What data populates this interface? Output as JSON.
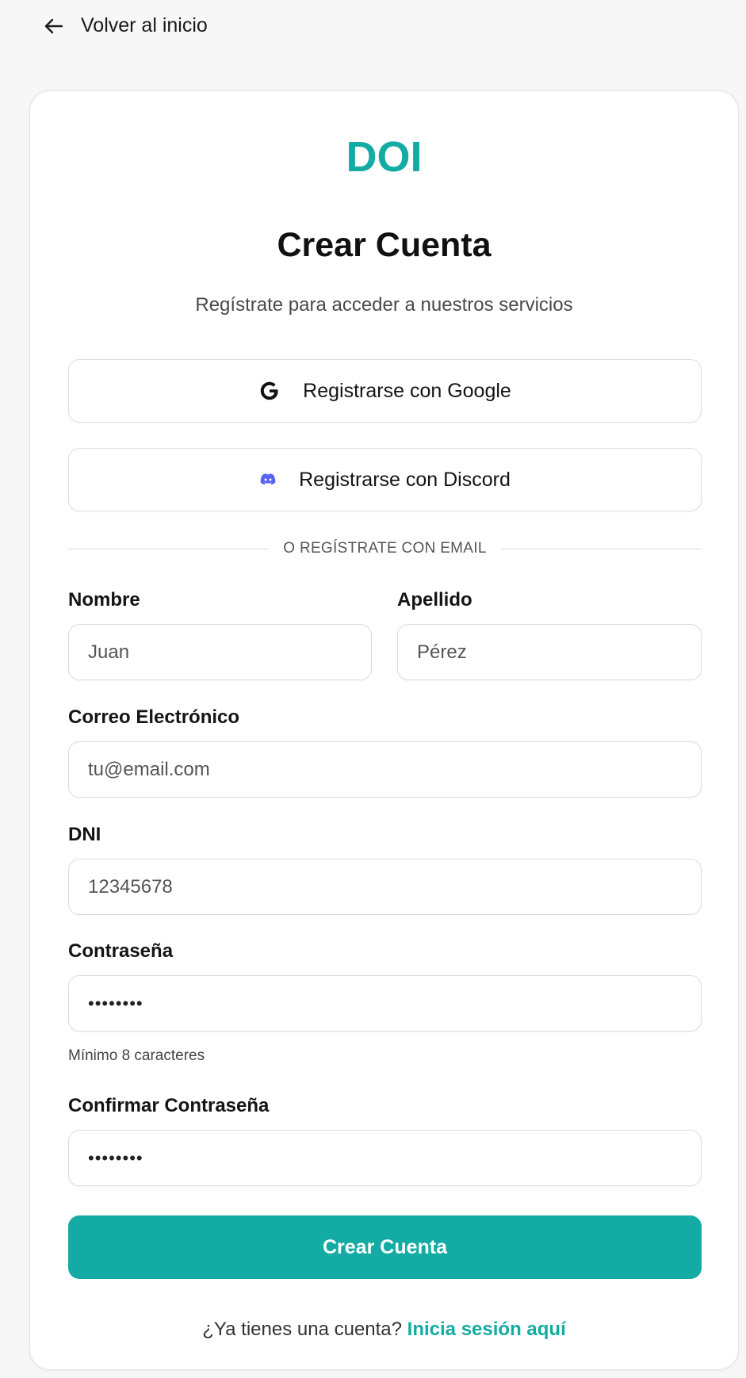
{
  "nav": {
    "back_label": "Volver al inicio"
  },
  "brand": {
    "logo_text": "DOI",
    "accent_color": "#13aba3"
  },
  "header": {
    "title": "Crear Cuenta",
    "subtitle": "Regístrate para acceder a nuestros servicios"
  },
  "oauth": {
    "google_label": "Registrarse con Google",
    "discord_label": "Registrarse con Discord"
  },
  "divider": {
    "text": "O REGÍSTRATE CON EMAIL"
  },
  "form": {
    "first_name": {
      "label": "Nombre",
      "placeholder": "Juan"
    },
    "last_name": {
      "label": "Apellido",
      "placeholder": "Pérez"
    },
    "email": {
      "label": "Correo Electrónico",
      "placeholder": "tu@email.com"
    },
    "dni": {
      "label": "DNI",
      "placeholder": "12345678"
    },
    "password": {
      "label": "Contraseña",
      "value": "••••••••",
      "hint": "Mínimo 8 caracteres"
    },
    "confirm_password": {
      "label": "Confirmar Contraseña",
      "value": "••••••••"
    },
    "submit_label": "Crear Cuenta"
  },
  "footer": {
    "prompt": "¿Ya tienes una cuenta?",
    "login_link": "Inicia sesión aquí"
  }
}
